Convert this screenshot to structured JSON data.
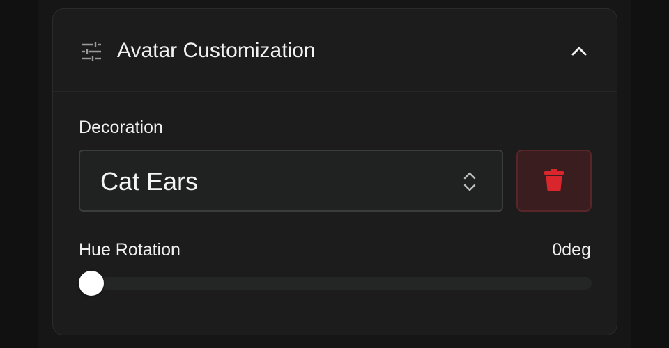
{
  "panel": {
    "title": "Avatar Customization",
    "header_icon": "sliders-icon",
    "collapse_icon": "chevron-up-icon",
    "expanded": true
  },
  "decoration": {
    "label": "Decoration",
    "selected": "Cat Ears",
    "select_icon": "chevron-up-down-icon",
    "delete_icon": "trash-icon"
  },
  "hue_rotation": {
    "label": "Hue Rotation",
    "value_text": "0deg",
    "value": 0,
    "min": 0,
    "max": 360
  },
  "colors": {
    "background": "#111111",
    "panel": "#1c1c1c",
    "danger_bg": "#3a1d1f",
    "danger_icon": "#d9262c",
    "thumb": "#ffffff"
  }
}
